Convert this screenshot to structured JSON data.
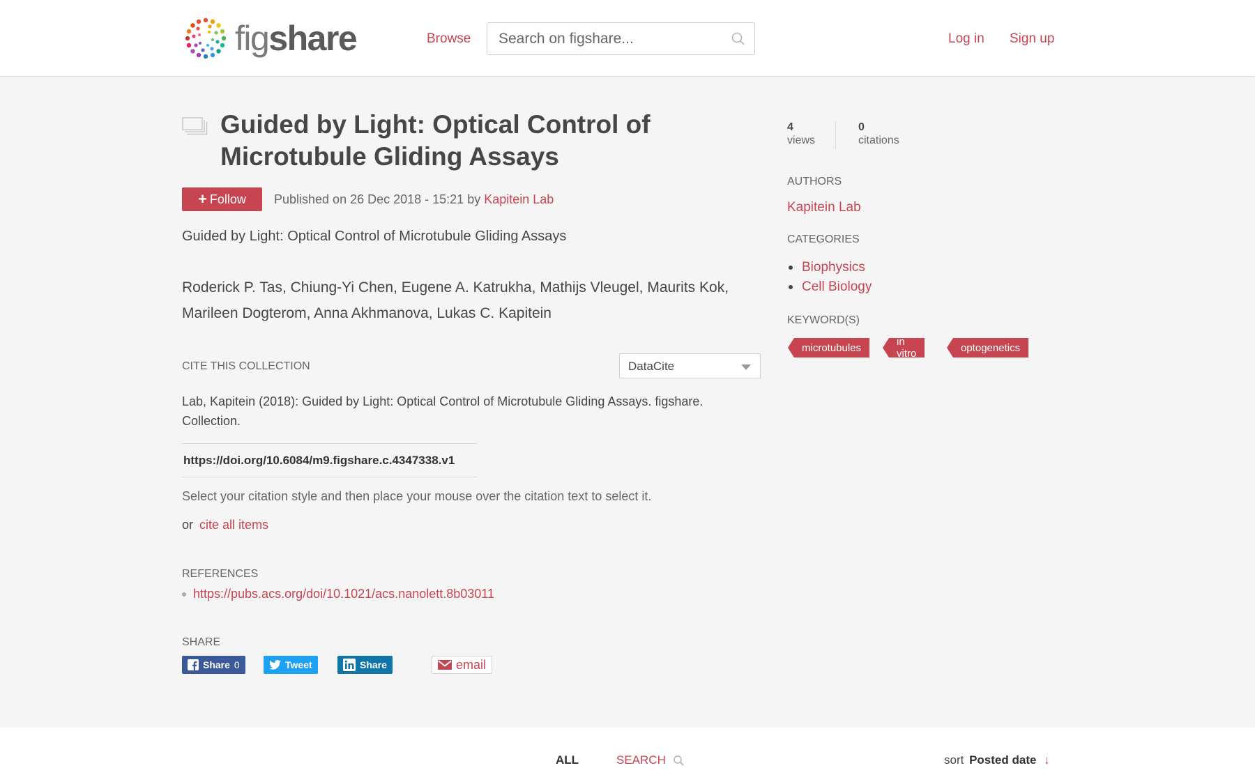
{
  "header": {
    "logo_fig": "fig",
    "logo_share": "share",
    "browse_label": "Browse",
    "search_placeholder": "Search on figshare...",
    "login_label": "Log in",
    "signup_label": "Sign up"
  },
  "item": {
    "title": "Guided by Light: Optical Control of Microtubule Gliding Assays",
    "follow_label": "Follow",
    "published_prefix": "Published on 26 Dec 2018 - 15:21 by",
    "published_by": "Kapitein Lab",
    "description": "Guided by Light: Optical Control of Microtubule Gliding Assays",
    "authors": "Roderick P. Tas, Chiung-Yi Chen, Eugene A. Katrukha, Mathijs Vleugel, Maurits Kok, Marileen Dogterom, Anna Akhmanova, Lukas C. Kapitein"
  },
  "cite": {
    "label": "Cite this collection",
    "style_selected": "DataCite",
    "citation_text": "Lab, Kapitein (2018): Guided by Light: Optical Control of Microtubule Gliding Assays. figshare. Collection.",
    "doi": "https://doi.org/10.6084/m9.figshare.c.4347338.v1",
    "hint": "Select your citation style and then place your mouse over the citation text to select it.",
    "or_text": "or",
    "cite_all_label": "cite all items"
  },
  "references": {
    "label": "References",
    "items": [
      "https://pubs.acs.org/doi/10.1021/acs.nanolett.8b03011"
    ]
  },
  "share": {
    "label": "Share",
    "facebook_label": "Share",
    "facebook_count": "0",
    "twitter_label": "Tweet",
    "linkedin_label": "Share",
    "email_label": "email"
  },
  "sidebar": {
    "views_count": "4",
    "views_label": "views",
    "citations_count": "0",
    "citations_label": "citations",
    "authors_label": "Authors",
    "authors": [
      "Kapitein Lab"
    ],
    "categories_label": "Categories",
    "categories": [
      "Biophysics",
      "Cell Biology"
    ],
    "keywords_label": "Keyword(s)",
    "keywords": [
      "microtubules",
      "in vitro",
      "optogenetics"
    ]
  },
  "bottom": {
    "tab_all": "ALL",
    "tab_search": "SEARCH",
    "sort_label": "sort",
    "sort_value": "Posted date",
    "sort_arrow": "↓"
  },
  "colors": {
    "accent": "#c74451",
    "facebook": "#3b5998",
    "twitter": "#1da1f2",
    "linkedin": "#0e76a8",
    "background": "#f5f5f5"
  },
  "icons": [
    "figshare-logo-icon",
    "search-icon",
    "collection-icon",
    "plus-icon",
    "facebook-icon",
    "twitter-icon",
    "linkedin-icon",
    "email-icon",
    "caret-down-icon"
  ]
}
